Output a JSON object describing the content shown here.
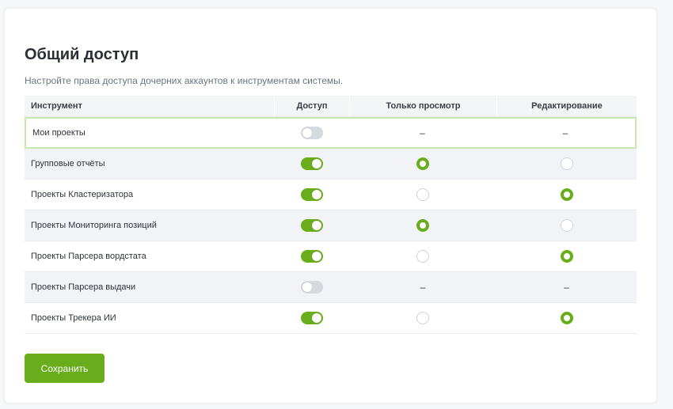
{
  "section": {
    "title": "Общий доступ",
    "subtitle": "Настройте права доступа дочерних аккаунтов к инструментам системы."
  },
  "table": {
    "headers": {
      "tool": "Инструмент",
      "access": "Доступ",
      "view_only": "Только просмотр",
      "edit": "Редактирование"
    },
    "rows": [
      {
        "name": "Мои проекты",
        "access": false,
        "permission": null
      },
      {
        "name": "Групповые отчёты",
        "access": true,
        "permission": "view"
      },
      {
        "name": "Проекты Кластеризатора",
        "access": true,
        "permission": "edit"
      },
      {
        "name": "Проекты Мониторинга позиций",
        "access": true,
        "permission": "view"
      },
      {
        "name": "Проекты Парсера вордстата",
        "access": true,
        "permission": "edit"
      },
      {
        "name": "Проекты Парсера выдачи",
        "access": false,
        "permission": null
      },
      {
        "name": "Проекты Трекера ИИ",
        "access": true,
        "permission": "edit"
      }
    ],
    "disabled_marker": "–"
  },
  "actions": {
    "save_label": "Сохранить"
  },
  "colors": {
    "accent": "#6aad1c",
    "toggle_off": "#d6d9de",
    "row_alt": "#f1f3f6",
    "highlight_border": "#cde6b0"
  }
}
